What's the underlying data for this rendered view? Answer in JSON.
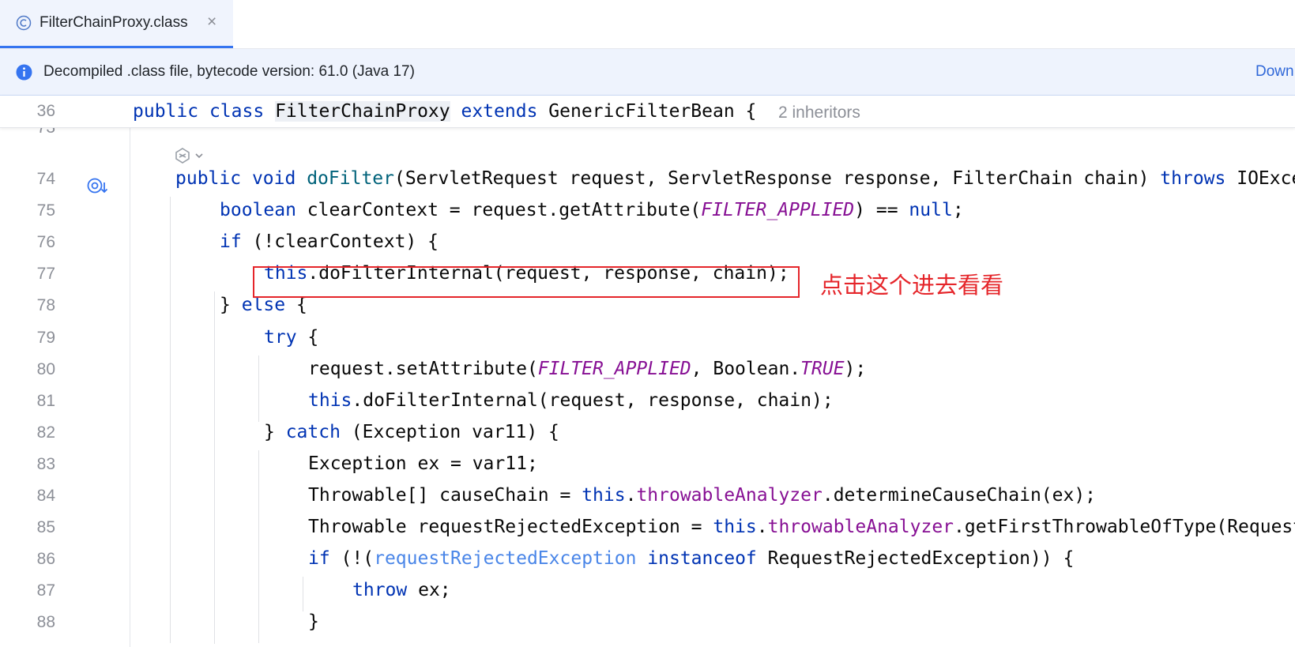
{
  "tab": {
    "label": "FilterChainProxy.class",
    "close_glyph": "×",
    "icon": "class-c-icon"
  },
  "banner": {
    "message": "Decompiled .class file, bytecode version: 61.0 (Java 17)",
    "link": "Down",
    "icon": "info-icon"
  },
  "sticky": {
    "line_number": "36",
    "kw_public": "public",
    "kw_class": "class",
    "class_name": "FilterChainProxy",
    "kw_extends": "extends",
    "rest": "GenericFilterBean {",
    "inheritors": "2 inheritors"
  },
  "partial_line_number": "73",
  "annotation": "点击这个进去看看",
  "colors": {
    "keyword": "#0033b3",
    "method": "#00627a",
    "constant": "#871094",
    "annotation": "#e5252a",
    "accent": "#3574f0"
  },
  "lines": [
    {
      "n": "74",
      "indent": 1,
      "tokens": [
        {
          "t": "public",
          "c": "kw"
        },
        {
          "t": " "
        },
        {
          "t": "void",
          "c": "kw"
        },
        {
          "t": " "
        },
        {
          "t": "doFilter",
          "c": "fn"
        },
        {
          "t": "(ServletRequest request, ServletResponse response, FilterChain chain) "
        },
        {
          "t": "throws",
          "c": "kw"
        },
        {
          "t": " IOException, ServletException {"
        }
      ]
    },
    {
      "n": "75",
      "indent": 2,
      "tokens": [
        {
          "t": "boolean",
          "c": "kw"
        },
        {
          "t": " clearContext = request.getAttribute("
        },
        {
          "t": "FILTER_APPLIED",
          "c": "it"
        },
        {
          "t": ") == "
        },
        {
          "t": "null",
          "c": "kw"
        },
        {
          "t": ";"
        }
      ]
    },
    {
      "n": "76",
      "indent": 2,
      "tokens": [
        {
          "t": "if",
          "c": "kw"
        },
        {
          "t": " (!clearContext) {"
        }
      ]
    },
    {
      "n": "77",
      "indent": 3,
      "tokens": [
        {
          "t": "this",
          "c": "kw"
        },
        {
          "t": ".doFilterInternal(request, response, chain);"
        }
      ]
    },
    {
      "n": "78",
      "indent": 2,
      "tokens": [
        {
          "t": "} "
        },
        {
          "t": "else",
          "c": "kw"
        },
        {
          "t": " {"
        }
      ]
    },
    {
      "n": "79",
      "indent": 3,
      "tokens": [
        {
          "t": "try",
          "c": "kw"
        },
        {
          "t": " {"
        }
      ]
    },
    {
      "n": "80",
      "indent": 4,
      "tokens": [
        {
          "t": "request.setAttribute("
        },
        {
          "t": "FILTER_APPLIED",
          "c": "it"
        },
        {
          "t": ", Boolean."
        },
        {
          "t": "TRUE",
          "c": "it"
        },
        {
          "t": ");"
        }
      ]
    },
    {
      "n": "81",
      "indent": 4,
      "tokens": [
        {
          "t": "this",
          "c": "kw"
        },
        {
          "t": ".doFilterInternal(request, response, chain);"
        }
      ]
    },
    {
      "n": "82",
      "indent": 3,
      "tokens": [
        {
          "t": "} "
        },
        {
          "t": "catch",
          "c": "kw"
        },
        {
          "t": " (Exception var11) {"
        }
      ]
    },
    {
      "n": "83",
      "indent": 4,
      "tokens": [
        {
          "t": "Exception ex = var11;"
        }
      ]
    },
    {
      "n": "84",
      "indent": 4,
      "tokens": [
        {
          "t": "Throwable[] causeChain = "
        },
        {
          "t": "this",
          "c": "kw"
        },
        {
          "t": "."
        },
        {
          "t": "throwableAnalyzer",
          "c": "fld"
        },
        {
          "t": ".determineCauseChain(ex);"
        }
      ]
    },
    {
      "n": "85",
      "indent": 4,
      "tokens": [
        {
          "t": "Throwable requestRejectedException = "
        },
        {
          "t": "this",
          "c": "kw"
        },
        {
          "t": "."
        },
        {
          "t": "throwableAnalyzer",
          "c": "fld"
        },
        {
          "t": ".getFirstThrowableOfType(RequestRejectedException.class, causeChain);"
        }
      ]
    },
    {
      "n": "86",
      "indent": 4,
      "tokens": [
        {
          "t": "if",
          "c": "kw"
        },
        {
          "t": " (!("
        },
        {
          "t": "requestRejectedException",
          "c": "hintvar"
        },
        {
          "t": " "
        },
        {
          "t": "instanceof",
          "c": "kw"
        },
        {
          "t": " RequestRejectedException)) {"
        }
      ]
    },
    {
      "n": "87",
      "indent": 5,
      "tokens": [
        {
          "t": "throw",
          "c": "kw"
        },
        {
          "t": " ex;"
        }
      ]
    },
    {
      "n": "88",
      "indent": 4,
      "tokens": [
        {
          "t": "}"
        }
      ]
    }
  ]
}
